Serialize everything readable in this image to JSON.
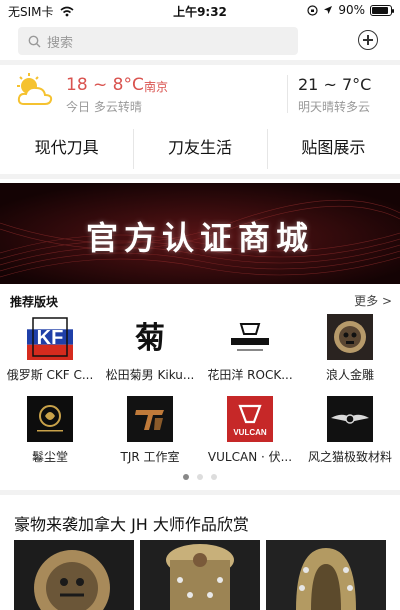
{
  "status": {
    "carrier": "无SIM卡",
    "time": "上午9:32",
    "battery": "90%",
    "battery_level": 0.9
  },
  "search": {
    "placeholder": "搜索"
  },
  "weather": {
    "today_temp": "18 ~ 8°C",
    "city": "南京",
    "today_desc": "今日 多云转晴",
    "tomorrow_temp": "21 ~ 7°C",
    "tomorrow_desc": "明天晴转多云"
  },
  "categories": [
    {
      "label": "现代刀具"
    },
    {
      "label": "刀友生活"
    },
    {
      "label": "贴图展示"
    }
  ],
  "banner": {
    "text": "官方认证商城"
  },
  "recommended": {
    "title": "推荐版块",
    "more": "更多 >",
    "items": [
      {
        "label": "俄罗斯 CKF C...",
        "logo": "ckf-flag-logo"
      },
      {
        "label": "松田菊男 Kiku...",
        "logo": "kiku-calligraphy-logo"
      },
      {
        "label": "花田洋 ROCK...",
        "logo": "rockstead-logo"
      },
      {
        "label": "浪人金雕",
        "logo": "skull-ring-logo"
      },
      {
        "label": "鬈尘堂",
        "logo": "gold-emblem-logo"
      },
      {
        "label": "TJR 工作室",
        "logo": "tjr-logo"
      },
      {
        "label": "VULCAN · 伏...",
        "logo": "vulcan-logo",
        "logo_text": "VULCAN"
      },
      {
        "label": "风之猫极致材料",
        "logo": "winged-badge-logo"
      }
    ],
    "page_count": 3,
    "active_page": 0
  },
  "feature": {
    "title": "豪物来袭加拿大 JH 大师作品欣赏"
  },
  "colors": {
    "accent_red": "#d9534f",
    "banner_bg": "#1d0506",
    "separator": "#f2f2f2"
  }
}
